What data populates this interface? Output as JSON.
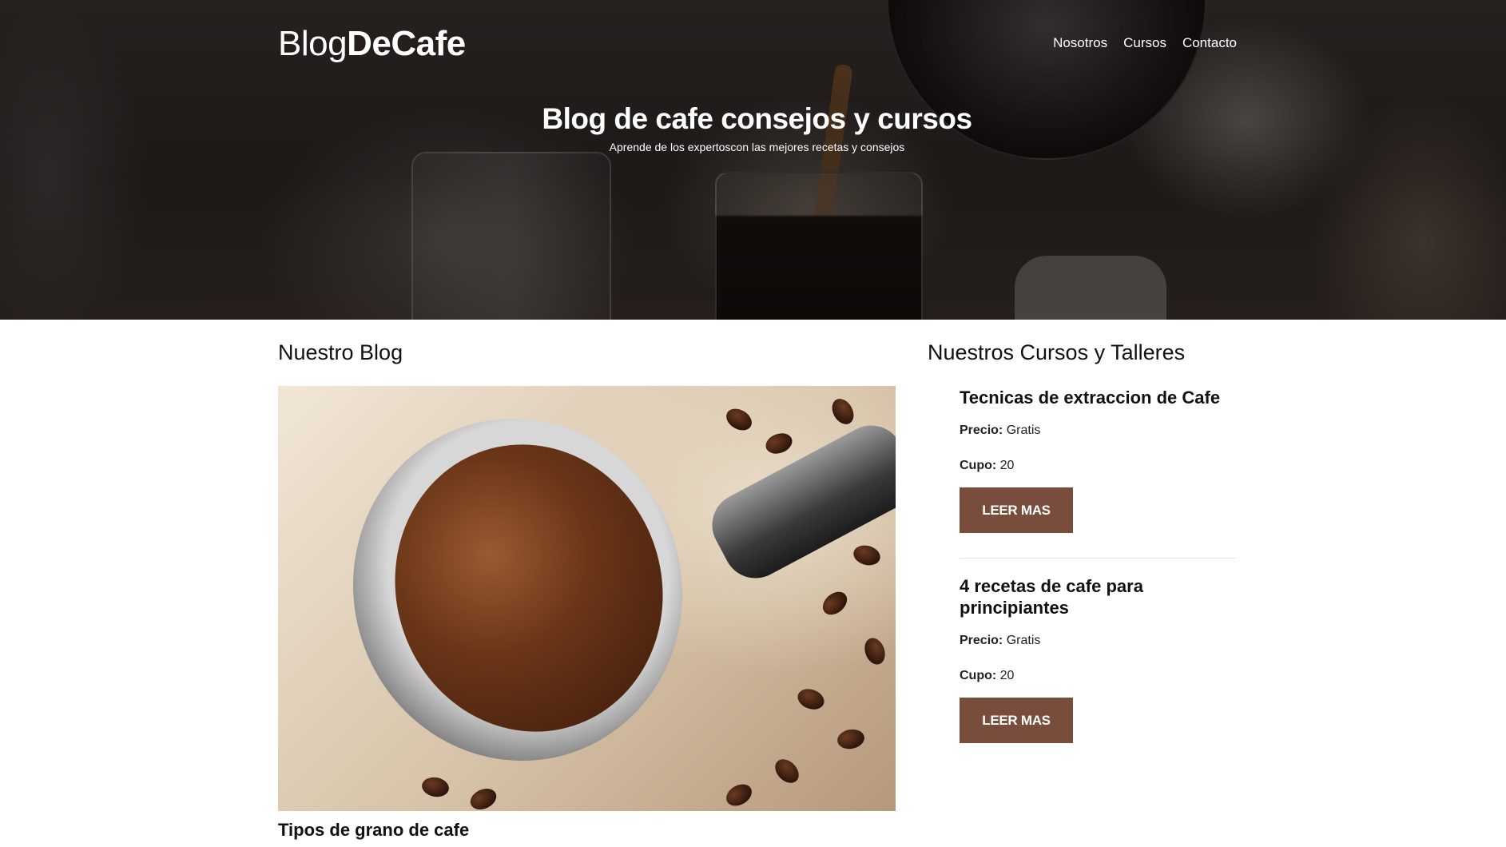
{
  "header": {
    "logo_light": "Blog",
    "logo_bold": "DeCafe",
    "nav": [
      {
        "label": "Nosotros"
      },
      {
        "label": "Cursos"
      },
      {
        "label": "Contacto"
      }
    ]
  },
  "hero": {
    "title": "Blog de cafe consejos y cursos",
    "subtitle": "Aprende de los expertoscon las mejores recetas y consejos"
  },
  "blog": {
    "heading": "Nuestro Blog",
    "posts": [
      {
        "title": "Tipos de grano de cafe"
      }
    ]
  },
  "courses": {
    "heading": "Nuestros Cursos y Talleres",
    "items": [
      {
        "title": "Tecnicas de extraccion de Cafe",
        "price_label": "Precio:",
        "price": "Gratis",
        "quota_label": "Cupo:",
        "quota": "20",
        "button": "LEER MAS"
      },
      {
        "title": "4 recetas de cafe para principiantes",
        "price_label": "Precio:",
        "price": "Gratis",
        "quota_label": "Cupo:",
        "quota": "20",
        "button": "LEER MAS"
      }
    ]
  },
  "colors": {
    "button": "#784d3c",
    "text": "#111111"
  }
}
